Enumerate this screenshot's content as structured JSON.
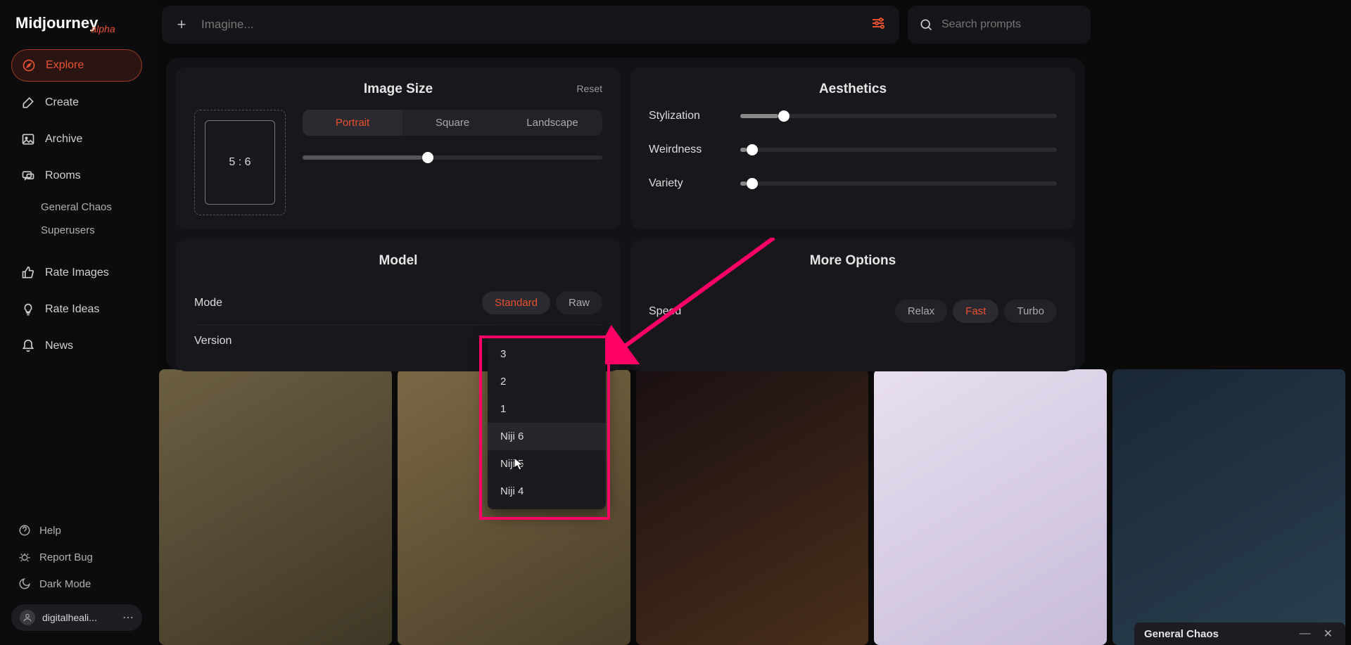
{
  "logo": {
    "main": "Midjourney",
    "tag": "alpha"
  },
  "prompt": {
    "placeholder": "Imagine..."
  },
  "search": {
    "placeholder": "Search prompts"
  },
  "sidebar": {
    "items": [
      {
        "label": "Explore"
      },
      {
        "label": "Create"
      },
      {
        "label": "Archive"
      },
      {
        "label": "Rooms"
      }
    ],
    "rooms": [
      {
        "label": "General Chaos"
      },
      {
        "label": "Superusers"
      }
    ],
    "secondary": [
      {
        "label": "Rate Images"
      },
      {
        "label": "Rate Ideas"
      },
      {
        "label": "News"
      }
    ],
    "footer": [
      {
        "label": "Help"
      },
      {
        "label": "Report Bug"
      },
      {
        "label": "Dark Mode"
      }
    ],
    "user": "digitalheali..."
  },
  "panels": {
    "image_size": {
      "title": "Image Size",
      "reset": "Reset",
      "ratio": "5 : 6",
      "segments": [
        "Portrait",
        "Square",
        "Landscape"
      ],
      "active_segment": 0,
      "slider_pct": 40
    },
    "aesthetics": {
      "title": "Aesthetics",
      "rows": [
        {
          "label": "Stylization",
          "pct": 12
        },
        {
          "label": "Weirdness",
          "pct": 2
        },
        {
          "label": "Variety",
          "pct": 2
        }
      ]
    },
    "model": {
      "title": "Model",
      "rows": [
        {
          "label": "Mode",
          "options": [
            "Standard",
            "Raw"
          ],
          "active": 0
        },
        {
          "label": "Version",
          "options": [],
          "active": -1
        }
      ]
    },
    "more": {
      "title": "More Options",
      "speed": {
        "label": "Speed",
        "options": [
          "Relax",
          "Fast",
          "Turbo"
        ],
        "active": 1
      }
    }
  },
  "dropdown": {
    "items": [
      "3",
      "2",
      "1",
      "Niji 6",
      "Niji 5",
      "Niji 4"
    ],
    "hovered": 3
  },
  "chat": {
    "title": "General Chaos"
  }
}
